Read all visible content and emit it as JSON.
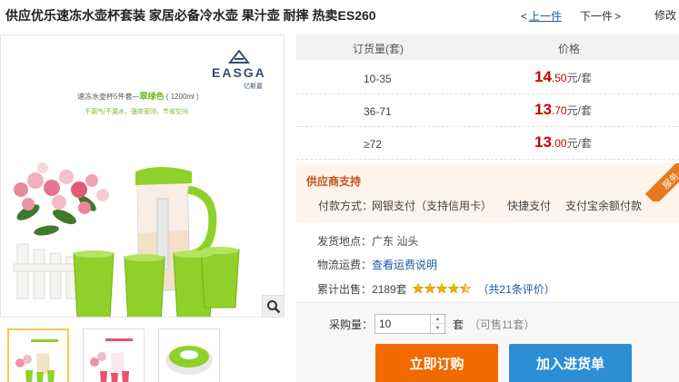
{
  "product": {
    "title": "供应优乐速冻水壶杯套装 家居必备冷水壶 果汁壶 耐摔 热卖ES260"
  },
  "nav": {
    "prev_arrow": "<",
    "prev_label": "上一件",
    "next_label": "下一件",
    "next_arrow": ">",
    "edit_label": "修改"
  },
  "image": {
    "brand_name": "EASGA",
    "brand_sub": "亿斯嘉",
    "promo_line1_prefix": "速冻水壶杯5件套—",
    "promo_line1_color": "翠绿色",
    "promo_line1_suffix": "( 1200ml )",
    "promo_line2": "不漏气/不漏水，强效密闭，节省空间",
    "zoom_icon": "magnifier-icon"
  },
  "price_table": {
    "header_qty": "订货量(套)",
    "header_price": "价格",
    "rows": [
      {
        "qty": "10-35",
        "int": "14",
        "dec": ".50",
        "unit": "元/套"
      },
      {
        "qty": "36-71",
        "int": "13",
        "dec": ".70",
        "unit": "元/套"
      },
      {
        "qty": "≥72",
        "int": "13",
        "dec": ".00",
        "unit": "元/套"
      }
    ]
  },
  "support": {
    "title": "供应商支持",
    "ribbon": "服务",
    "payment_label": "付款方式：",
    "options": [
      "网银支付（支持信用卡）",
      "快捷支付",
      "支付宝余额付款"
    ]
  },
  "shipping": {
    "from_label": "发货地点：",
    "from_value": "广东 汕头",
    "fee_label": "物流运费：",
    "fee_link": "查看运费说明",
    "sold_label": "累计出售：",
    "sold_value": "2189套",
    "rating_stars": 4.5,
    "reviews_link": "（共21条评价）"
  },
  "order": {
    "qty_label": "采购量：",
    "qty_value": "10",
    "qty_unit": "套",
    "available": "（可售11套）",
    "buy_button": "立即订购",
    "cart_button": "加入进货单"
  },
  "colors": {
    "price_red": "#cc0000",
    "buy_orange": "#f06a00",
    "cart_blue": "#2c8fd6",
    "link_blue": "#1c5aa6",
    "support_bg": "#fff4ec",
    "cup_green": "#8fd12a"
  }
}
